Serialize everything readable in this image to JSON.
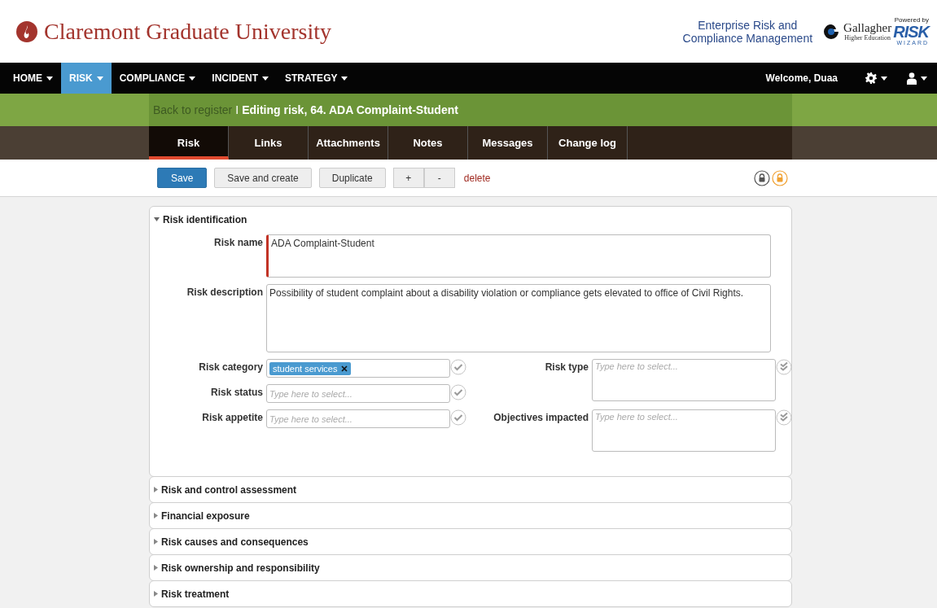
{
  "header": {
    "university": "Claremont Graduate University",
    "product_lines": [
      "Enterprise Risk and",
      "Compliance Management"
    ],
    "partner": {
      "name": "Gallagher",
      "subtitle": "Higher Education"
    },
    "powered": {
      "label": "Powered by",
      "word": "RISK",
      "sub": "WIZARD"
    }
  },
  "nav": {
    "items": [
      {
        "label": "HOME",
        "selected": false
      },
      {
        "label": "RISK",
        "selected": true
      },
      {
        "label": "COMPLIANCE",
        "selected": false
      },
      {
        "label": "INCIDENT",
        "selected": false
      },
      {
        "label": "STRATEGY",
        "selected": false
      }
    ],
    "welcome": "Welcome, Duaa"
  },
  "breadcrumb": {
    "link": "Back to register",
    "separator": "I",
    "title": "Editing risk, 64. ADA Complaint-Student"
  },
  "tabs": [
    {
      "label": "Risk",
      "selected": true
    },
    {
      "label": "Links",
      "selected": false
    },
    {
      "label": "Attachments",
      "selected": false
    },
    {
      "label": "Notes",
      "selected": false
    },
    {
      "label": "Messages",
      "selected": false
    },
    {
      "label": "Change log",
      "selected": false
    }
  ],
  "toolbar": {
    "buttons": [
      {
        "label": "Save",
        "kind": "primary"
      },
      {
        "label": "Save and create",
        "kind": "default"
      },
      {
        "label": "Duplicate",
        "kind": "default"
      },
      {
        "label": "+",
        "kind": "group"
      },
      {
        "label": "-",
        "kind": "group"
      },
      {
        "label": "delete",
        "kind": "link"
      }
    ],
    "locks": [
      {
        "color": "#555555"
      },
      {
        "color": "#f0a030"
      }
    ]
  },
  "sections": [
    {
      "title": "Risk identification",
      "expanded": true,
      "text_fields": [
        {
          "label": "Risk name",
          "value": "ADA Complaint-Student",
          "invalid": true,
          "kind": "short"
        },
        {
          "label": "Risk description",
          "value": "Possibility of student complaint about a disability violation or compliance gets elevated to office of Civil Rights.",
          "invalid": false,
          "kind": "long"
        }
      ],
      "left_fields": [
        {
          "label": "Risk category",
          "kind": "single",
          "tags": [
            "student services"
          ]
        },
        {
          "label": "Risk status",
          "kind": "single",
          "placeholder": "Type here to select..."
        },
        {
          "label": "Risk appetite",
          "kind": "single",
          "placeholder": "Type here to select..."
        }
      ],
      "right_fields": [
        {
          "label": "Risk type",
          "kind": "multi",
          "placeholder": "Type here to select..."
        },
        {
          "label": "Objectives impacted",
          "kind": "multi",
          "placeholder": "Type here to select..."
        }
      ]
    },
    {
      "title": "Risk and control assessment",
      "expanded": false
    },
    {
      "title": "Financial exposure",
      "expanded": false
    },
    {
      "title": "Risk causes and consequences",
      "expanded": false
    },
    {
      "title": "Risk ownership and responsibility",
      "expanded": false
    },
    {
      "title": "Risk treatment",
      "expanded": false
    }
  ]
}
